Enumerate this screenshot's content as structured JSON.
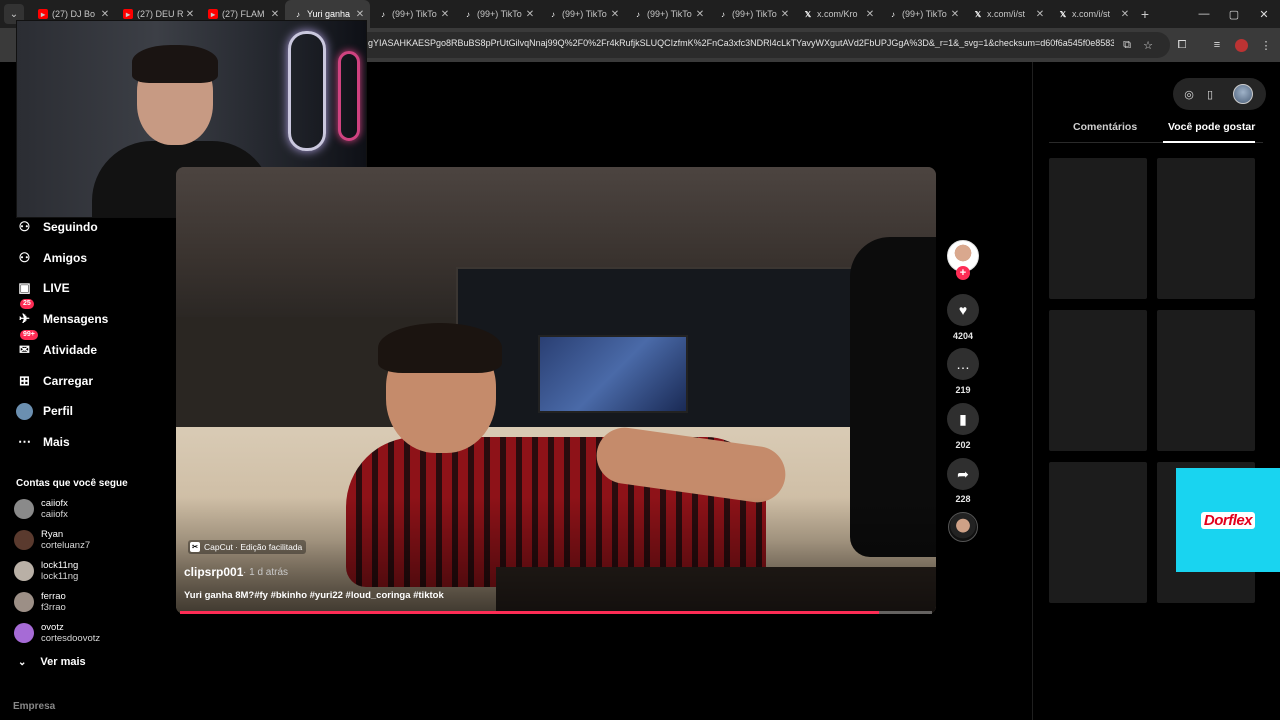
{
  "browser": {
    "tabs": [
      {
        "icon": "youtube-icon",
        "label": "(27) DJ Bo",
        "active": false
      },
      {
        "icon": "youtube-icon",
        "label": "(27) DEU R",
        "active": false
      },
      {
        "icon": "youtube-icon",
        "label": "(27) FLAM",
        "active": false
      },
      {
        "icon": "tiktok-icon",
        "label": "Yuri ganha",
        "active": true
      },
      {
        "icon": "tiktok-icon",
        "label": "(99+) TikTo",
        "active": false
      },
      {
        "icon": "tiktok-icon",
        "label": "(99+) TikTo",
        "active": false
      },
      {
        "icon": "tiktok-icon",
        "label": "(99+) TikTo",
        "active": false
      },
      {
        "icon": "tiktok-icon",
        "label": "(99+) TikTo",
        "active": false
      },
      {
        "icon": "tiktok-icon",
        "label": "(99+) TikTo",
        "active": false
      },
      {
        "icon": "x-icon",
        "label": "x.com/Kro",
        "active": false
      },
      {
        "icon": "tiktok-icon",
        "label": "(99+) TikTo",
        "active": false
      },
      {
        "icon": "x-icon",
        "label": "x.com/i/st",
        "active": false
      },
      {
        "icon": "x-icon",
        "label": "x.com/i/st",
        "active": false
      }
    ],
    "url": "gYIASAHKAESPgo8RBuBS8pPrUtGilvqNnaj99Q%2F0%2Fr4kRufjkSLUQCIzfmK%2FnCa3xfc3NDRl4cLkTYavyWXgutAVd2FbUPJGgA%3D&_r=1&_svg=1&checksum=d60f6a545f0e8583..."
  },
  "nav": {
    "items": [
      {
        "name": "nav-following",
        "icon": "following-icon",
        "glyph": "⚇",
        "label": "Seguindo",
        "badge": ""
      },
      {
        "name": "nav-friends",
        "icon": "friends-icon",
        "glyph": "⚇",
        "label": "Amigos",
        "badge": ""
      },
      {
        "name": "nav-live",
        "icon": "live-icon",
        "glyph": "▣",
        "label": "LIVE",
        "badge": ""
      },
      {
        "name": "nav-messages",
        "icon": "messages-icon",
        "glyph": "✈",
        "label": "Mensagens",
        "badge": "25"
      },
      {
        "name": "nav-activity",
        "icon": "activity-icon",
        "glyph": "✉",
        "label": "Atividade",
        "badge": "99+"
      },
      {
        "name": "nav-upload",
        "icon": "upload-icon",
        "glyph": "⊞",
        "label": "Carregar",
        "badge": ""
      },
      {
        "name": "nav-profile",
        "icon": "profile-avatar-icon",
        "glyph": "●",
        "label": "Perfil",
        "badge": ""
      },
      {
        "name": "nav-more",
        "icon": "more-icon",
        "glyph": "⋯",
        "label": "Mais",
        "badge": ""
      }
    ],
    "following_heading": "Contas que você segue",
    "accounts": [
      {
        "name": "caiiofx",
        "handle": "caiiofx",
        "color": "#8a8a8a"
      },
      {
        "name": "Ryan",
        "handle": "corteluanz7",
        "color": "#5a3a2e"
      },
      {
        "name": "lock11ng",
        "handle": "lock11ng",
        "color": "#b9b0a6"
      },
      {
        "name": "ferrao",
        "handle": "f3rrao",
        "color": "#9c8f86"
      },
      {
        "name": "ovotz",
        "handle": "cortesdoovotz",
        "color": "#a66bd6"
      }
    ],
    "see_more": "Ver mais",
    "company": "Empresa"
  },
  "video": {
    "capcut_label": "CapCut · Edição facilitada",
    "author": "clipsrp001",
    "posted": "· 1 d atrás",
    "caption": "Yuri ganha 8M?#fy #bkinho #yuri22 #loud_coringa #tiktok",
    "progress": 0.93
  },
  "actions": {
    "likes": "4204",
    "comments": "219",
    "saves": "202",
    "shares": "228"
  },
  "right_panel": {
    "tab_comments": "Comentários",
    "tab_recommended": "Você pode gostar",
    "ad_text": "Dorflex"
  },
  "colors": {
    "accent": "#fe2c55",
    "ad_background": "#19d4f0",
    "ad_text": "#e3001b"
  }
}
